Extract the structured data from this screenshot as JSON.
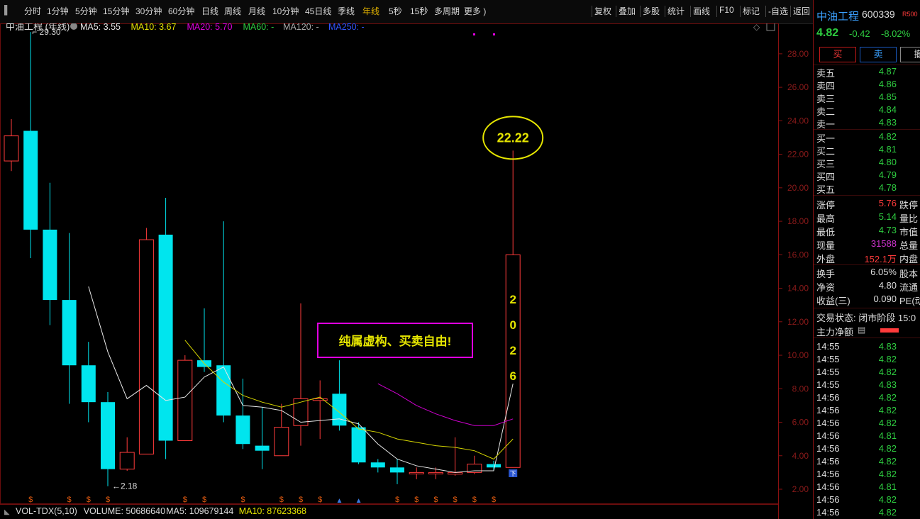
{
  "toolbar": {
    "periods": [
      "分时",
      "1分钟",
      "5分钟",
      "15分钟",
      "30分钟",
      "60分钟",
      "日线",
      "周线",
      "月线",
      "10分钟",
      "45日线",
      "季线",
      "年线",
      "5秒",
      "15秒",
      "多周期",
      "更多 )"
    ],
    "active_period": "年线",
    "right_buttons": [
      "复权",
      "叠加",
      "多股",
      "统计",
      "画线",
      "F10",
      "标记",
      "-自选",
      "返回"
    ]
  },
  "chart_header": {
    "name": "中油工程 (年线)",
    "indicators": [
      {
        "text": "MA5: 3.55",
        "color": "#e8e8e8"
      },
      {
        "text": "MA10: 3.67",
        "color": "#e6e600"
      },
      {
        "text": "MA20: 5.70",
        "color": "#e000e0"
      },
      {
        "text": "MA60: -",
        "color": "#2ecc40"
      },
      {
        "text": "MA120: -",
        "color": "#aaaaaa"
      },
      {
        "text": "MA250: -",
        "color": "#3355ff"
      }
    ]
  },
  "chart_data": {
    "type": "candlestick",
    "y_axis_ticks": [
      "28.00",
      "26.00",
      "24.00",
      "22.00",
      "20.00",
      "18.00",
      "16.00",
      "14.00",
      "12.00",
      "10.00",
      "8.00",
      "6.00",
      "4.00",
      "2.00"
    ],
    "ylim": [
      1.2,
      30.3
    ],
    "candles": [
      {
        "o": 21.6,
        "h": 24.1,
        "l": 21.0,
        "c": 23.1
      },
      {
        "o": 23.4,
        "h": 29.3,
        "l": 15.8,
        "c": 17.5
      },
      {
        "o": 17.5,
        "h": 20.3,
        "l": 11.8,
        "c": 13.3
      },
      {
        "o": 13.3,
        "h": 17.3,
        "l": 7.1,
        "c": 9.4
      },
      {
        "o": 9.4,
        "h": 10.8,
        "l": 6.0,
        "c": 7.2
      },
      {
        "o": 7.2,
        "h": 7.8,
        "l": 2.18,
        "c": 3.2
      },
      {
        "o": 3.2,
        "h": 5.1,
        "l": 3.1,
        "c": 4.2
      },
      {
        "o": 4.1,
        "h": 17.6,
        "l": 4.1,
        "c": 16.9
      },
      {
        "o": 17.2,
        "h": 19.4,
        "l": 3.8,
        "c": 4.9
      },
      {
        "o": 4.9,
        "h": 10.0,
        "l": 4.9,
        "c": 9.7
      },
      {
        "o": 9.7,
        "h": 12.8,
        "l": 9.0,
        "c": 9.3
      },
      {
        "o": 9.4,
        "h": 18.0,
        "l": 6.0,
        "c": 6.4
      },
      {
        "o": 6.4,
        "h": 8.6,
        "l": 4.4,
        "c": 4.7
      },
      {
        "o": 4.6,
        "h": 6.9,
        "l": 3.2,
        "c": 4.3
      },
      {
        "o": 4.0,
        "h": 7.1,
        "l": 4.0,
        "c": 5.7
      },
      {
        "o": 5.8,
        "h": 13.1,
        "l": 4.6,
        "c": 7.4
      },
      {
        "o": 7.3,
        "h": 8.5,
        "l": 5.0,
        "c": 7.4
      },
      {
        "o": 7.7,
        "h": 9.7,
        "l": 5.5,
        "c": 5.8
      },
      {
        "o": 5.7,
        "h": 6.0,
        "l": 3.5,
        "c": 3.6
      },
      {
        "o": 3.6,
        "h": 3.8,
        "l": 3.0,
        "c": 3.3
      },
      {
        "o": 3.3,
        "h": 3.8,
        "l": 2.3,
        "c": 3.0
      },
      {
        "o": 3.0,
        "h": 3.3,
        "l": 2.6,
        "c": 3.0
      },
      {
        "o": 3.0,
        "h": 3.3,
        "l": 2.6,
        "c": 3.0
      },
      {
        "o": 2.9,
        "h": 5.1,
        "l": 2.8,
        "c": 3.0
      },
      {
        "o": 3.0,
        "h": 4.0,
        "l": 2.9,
        "c": 3.5
      },
      {
        "o": 3.5,
        "h": 3.7,
        "l": 3.1,
        "c": 3.3
      },
      {
        "o": 3.3,
        "h": 22.22,
        "l": 3.3,
        "c": 16.0
      }
    ],
    "ma5": [
      null,
      null,
      null,
      null,
      14.1,
      10.2,
      7.4,
      8.2,
      7.3,
      7.5,
      8.7,
      9.3,
      7.0,
      6.9,
      6.7,
      6.0,
      6.1,
      6.2,
      5.9,
      4.7,
      3.8,
      3.4,
      3.2,
      3.0,
      3.1,
      3.1,
      8.3
    ],
    "ma10": [
      null,
      null,
      null,
      null,
      null,
      null,
      null,
      null,
      null,
      10.9,
      9.5,
      8.4,
      7.6,
      7.2,
      6.9,
      7.2,
      7.5,
      6.6,
      5.6,
      5.4,
      5.0,
      4.8,
      4.6,
      4.5,
      4.3,
      3.8,
      5.0
    ],
    "ma20": [
      null,
      null,
      null,
      null,
      null,
      null,
      null,
      null,
      null,
      null,
      null,
      null,
      null,
      null,
      null,
      null,
      null,
      null,
      null,
      8.3,
      7.7,
      7.0,
      6.5,
      6.1,
      5.8,
      5.8,
      6.2
    ],
    "high_label": "29.30",
    "low_label": "2.18",
    "max_label": "22.22",
    "vertical_text": [
      "2",
      "0",
      "2",
      "6"
    ],
    "annotation": "纯属虚构、买卖自由!",
    "dollar_marker_indices": [
      1,
      3,
      4,
      5,
      9,
      10,
      12,
      14,
      15,
      16,
      20,
      21,
      22,
      23,
      24,
      25
    ],
    "triangle_marker_indices": [
      17,
      18
    ]
  },
  "volume_header": {
    "name": "VOL-TDX(5,10)",
    "volume": "VOLUME: 50686640",
    "ma5": "MA5: 109679144",
    "ma10": "MA10: 87623368"
  },
  "side": {
    "stock_name": "中油工程",
    "code": "600339",
    "tag": "R500",
    "price": "4.82",
    "change": "-0.42",
    "change_pct": "-8.02%",
    "buy_label": "买",
    "sell_label": "卖",
    "cancel_label": "撤",
    "asks": [
      {
        "label": "卖五",
        "price": "4.87"
      },
      {
        "label": "卖四",
        "price": "4.86"
      },
      {
        "label": "卖三",
        "price": "4.85"
      },
      {
        "label": "卖二",
        "price": "4.84"
      },
      {
        "label": "卖一",
        "price": "4.83"
      }
    ],
    "bids": [
      {
        "label": "买一",
        "price": "4.82"
      },
      {
        "label": "买二",
        "price": "4.81"
      },
      {
        "label": "买三",
        "price": "4.80"
      },
      {
        "label": "买四",
        "price": "4.79"
      },
      {
        "label": "买五",
        "price": "4.78"
      }
    ],
    "stats": [
      {
        "l": "涨停",
        "v": "5.76",
        "color": "#ff3b3b",
        "l2": "跌停"
      },
      {
        "l": "最高",
        "v": "5.14",
        "color": "#2ecc40",
        "l2": "量比"
      },
      {
        "l": "最低",
        "v": "4.73",
        "color": "#2ecc40",
        "l2": "市值"
      },
      {
        "l": "现量",
        "v": "31588",
        "color": "#cc33cc",
        "l2": "总量"
      },
      {
        "l": "外盘",
        "v": "152.1万",
        "color": "#ff3b3b",
        "l2": "内盘"
      }
    ],
    "stats2": [
      {
        "l": "换手",
        "v": "6.05%",
        "color": "#dddddd",
        "l2": "股本"
      },
      {
        "l": "净资",
        "v": "4.80",
        "color": "#dddddd",
        "l2": "流通"
      },
      {
        "l": "收益(三)",
        "v": "0.090",
        "color": "#dddddd",
        "l2": "PE(动"
      }
    ],
    "trade_status": "交易状态: 闭市阶段 15:0",
    "net_flow_label": "主力净额",
    "ticks": [
      {
        "t": "14:55",
        "p": "4.83"
      },
      {
        "t": "14:55",
        "p": "4.82"
      },
      {
        "t": "14:55",
        "p": "4.82"
      },
      {
        "t": "14:55",
        "p": "4.83"
      },
      {
        "t": "14:56",
        "p": "4.82"
      },
      {
        "t": "14:56",
        "p": "4.82"
      },
      {
        "t": "14:56",
        "p": "4.82"
      },
      {
        "t": "14:56",
        "p": "4.81"
      },
      {
        "t": "14:56",
        "p": "4.82"
      },
      {
        "t": "14:56",
        "p": "4.82"
      },
      {
        "t": "14:56",
        "p": "4.82"
      },
      {
        "t": "14:56",
        "p": "4.81"
      },
      {
        "t": "14:56",
        "p": "4.82"
      },
      {
        "t": "14:56",
        "p": "4.82"
      }
    ]
  }
}
